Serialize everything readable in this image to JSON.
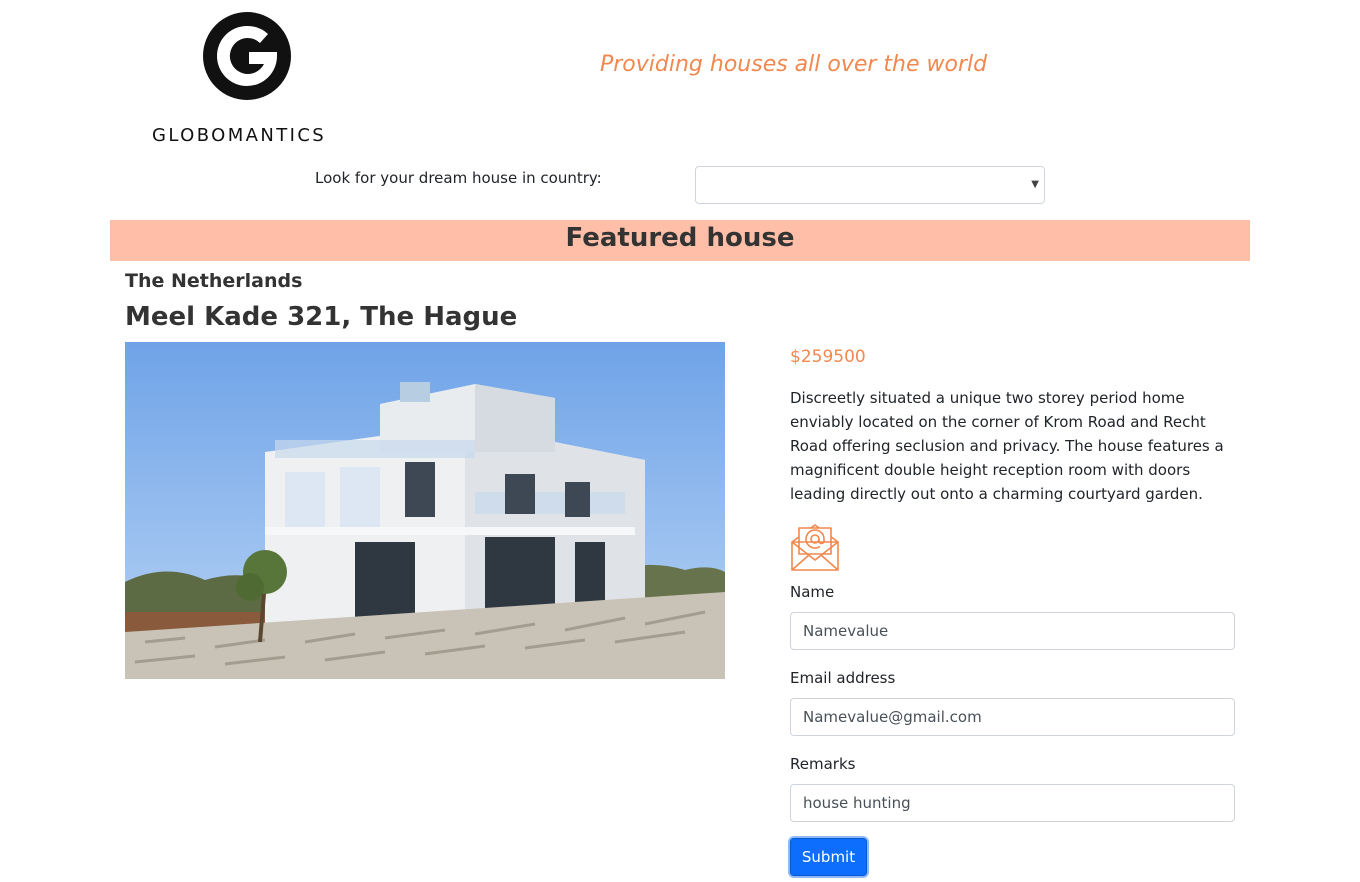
{
  "header": {
    "logo_text": "GLOBOMANTICS",
    "tagline": "Providing houses all over the world"
  },
  "search": {
    "label": "Look for your dream house in country:",
    "selected_value": ""
  },
  "featured": {
    "heading": "Featured house",
    "country": "The Netherlands",
    "address": "Meel Kade 321, The Hague",
    "price": "$259500",
    "description": "Discreetly situated a unique two storey period home enviably located on the corner of Krom Road and Recht Road offering seclusion and privacy. The house features a magnificent double height reception room with doors leading directly out onto a charming courtyard garden."
  },
  "form": {
    "icon": "mail-at-icon",
    "name_label": "Name",
    "name_value": "Namevalue",
    "email_label": "Email address",
    "email_value": "Namevalue@gmail.com",
    "remarks_label": "Remarks",
    "remarks_value": "house hunting",
    "submit_label": "Submit"
  },
  "colors": {
    "accent": "#f0884f",
    "band": "#ffbea7",
    "button": "#0d6efd"
  }
}
